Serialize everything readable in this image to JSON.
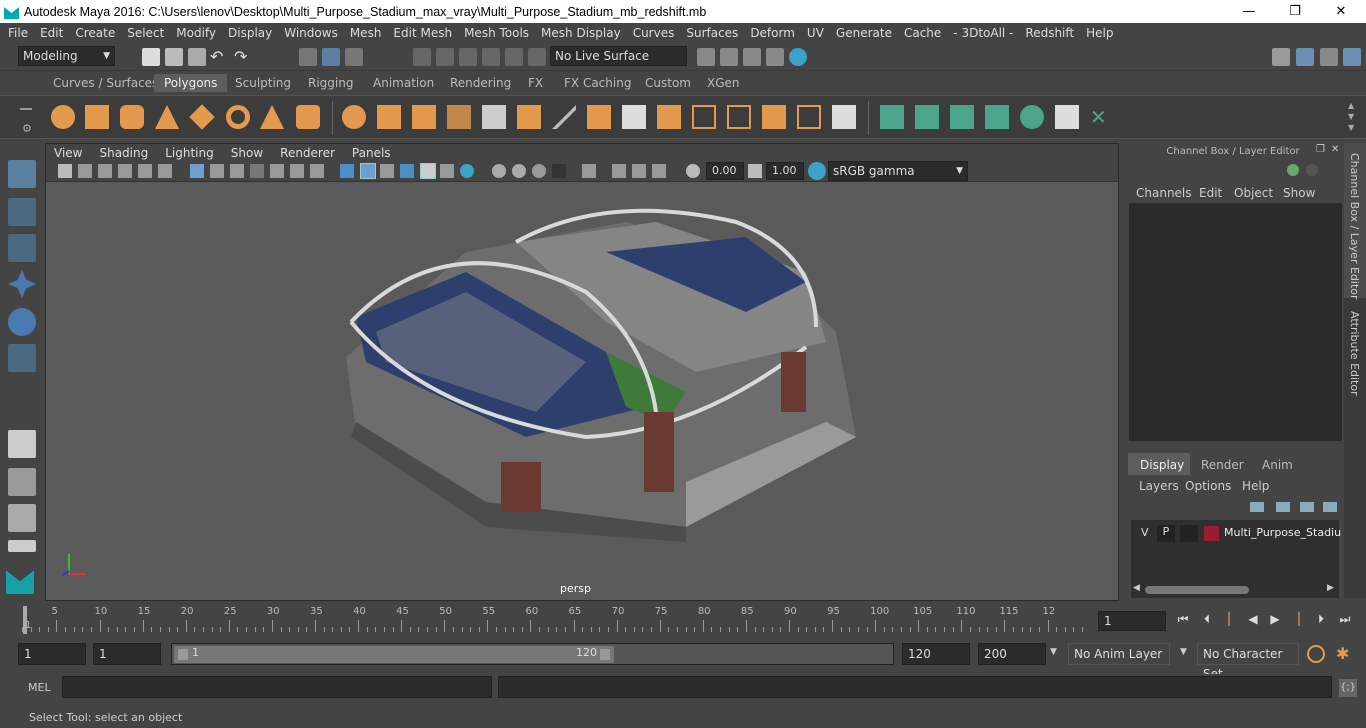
{
  "window": {
    "title": "Autodesk Maya 2016: C:\\Users\\lenov\\Desktop\\Multi_Purpose_Stadium_max_vray\\Multi_Purpose_Stadium_mb_redshift.mb",
    "minimize": "—",
    "restore": "❐",
    "close": "✕"
  },
  "menubar": [
    "File",
    "Edit",
    "Create",
    "Select",
    "Modify",
    "Display",
    "Windows",
    "Mesh",
    "Edit Mesh",
    "Mesh Tools",
    "Mesh Display",
    "Curves",
    "Surfaces",
    "Deform",
    "UV",
    "Generate",
    "Cache",
    "- 3DtoAll -",
    "Redshift",
    "Help"
  ],
  "statusline": {
    "mode": "Modeling",
    "live_surface": "No Live Surface"
  },
  "shelf_tabs": [
    "Curves / Surfaces",
    "Polygons",
    "Sculpting",
    "Rigging",
    "Animation",
    "Rendering",
    "FX",
    "FX Caching",
    "Custom",
    "XGen"
  ],
  "shelf_active": "Polygons",
  "viewport": {
    "menu": [
      "View",
      "Shading",
      "Lighting",
      "Show",
      "Renderer",
      "Panels"
    ],
    "exposure": "0.00",
    "gamma": "1.00",
    "colorspace": "sRGB gamma",
    "camera_label": "persp"
  },
  "channel_box": {
    "title": "Channel Box / Layer Editor",
    "menu": [
      "Channels",
      "Edit",
      "Object",
      "Show"
    ]
  },
  "side_tabs": [
    "Channel Box / Layer Editor",
    "Attribute Editor"
  ],
  "layer_editor": {
    "tabs": [
      "Display",
      "Render",
      "Anim"
    ],
    "active_tab": "Display",
    "menu": [
      "Layers",
      "Options",
      "Help"
    ],
    "layer": {
      "v": "V",
      "p": "P",
      "name": "Multi_Purpose_Stadium",
      "color": "#9b1b30"
    }
  },
  "timeline": {
    "ticks": [
      "5",
      "10",
      "15",
      "20",
      "25",
      "30",
      "35",
      "40",
      "45",
      "50",
      "55",
      "60",
      "65",
      "70",
      "75",
      "80",
      "85",
      "90",
      "95",
      "100",
      "105",
      "110",
      "115",
      "12"
    ],
    "start_marker": "1",
    "current_frame": "1"
  },
  "range": {
    "start": "1",
    "playback_start": "1",
    "slider_start": "1",
    "slider_end": "120",
    "playback_end": "120",
    "end": "200",
    "anim_layer": "No Anim Layer",
    "character_set": "No Character Set"
  },
  "mel": {
    "label": "MEL"
  },
  "help_line": "Select Tool: select an object"
}
